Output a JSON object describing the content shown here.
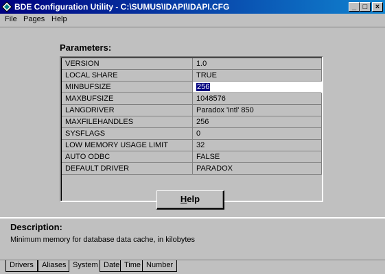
{
  "window": {
    "title": "BDE Configuration Utility - C:\\SUMUS\\IDAPI\\IDAPI.CFG",
    "controls": {
      "minimize": "_",
      "maximize": "□",
      "close": "×"
    }
  },
  "menu": [
    "File",
    "Pages",
    "Help"
  ],
  "parameters": {
    "title": "Parameters:",
    "rows": [
      {
        "name": "VERSION",
        "value": "1.0"
      },
      {
        "name": "LOCAL SHARE",
        "value": "TRUE"
      },
      {
        "name": "MINBUFSIZE",
        "value": "256",
        "selected": true
      },
      {
        "name": "MAXBUFSIZE",
        "value": "1048576"
      },
      {
        "name": "LANGDRIVER",
        "value": "Paradox 'intl' 850"
      },
      {
        "name": "MAXFILEHANDLES",
        "value": "256"
      },
      {
        "name": "SYSFLAGS",
        "value": "0"
      },
      {
        "name": "LOW MEMORY USAGE LIMIT",
        "value": "32"
      },
      {
        "name": "AUTO ODBC",
        "value": "FALSE"
      },
      {
        "name": "DEFAULT DRIVER",
        "value": "PARADOX"
      }
    ]
  },
  "help_button": {
    "accel": "H",
    "rest": "elp"
  },
  "description": {
    "title": "Description:",
    "text": "Minimum memory for database data cache, in kilobytes"
  },
  "tabs": [
    {
      "label": "Drivers",
      "active": false
    },
    {
      "label": "Aliases",
      "active": false
    },
    {
      "label": "System",
      "active": true
    },
    {
      "label": "Date",
      "active": false
    },
    {
      "label": "Time",
      "active": false
    },
    {
      "label": "Number",
      "active": false
    }
  ]
}
